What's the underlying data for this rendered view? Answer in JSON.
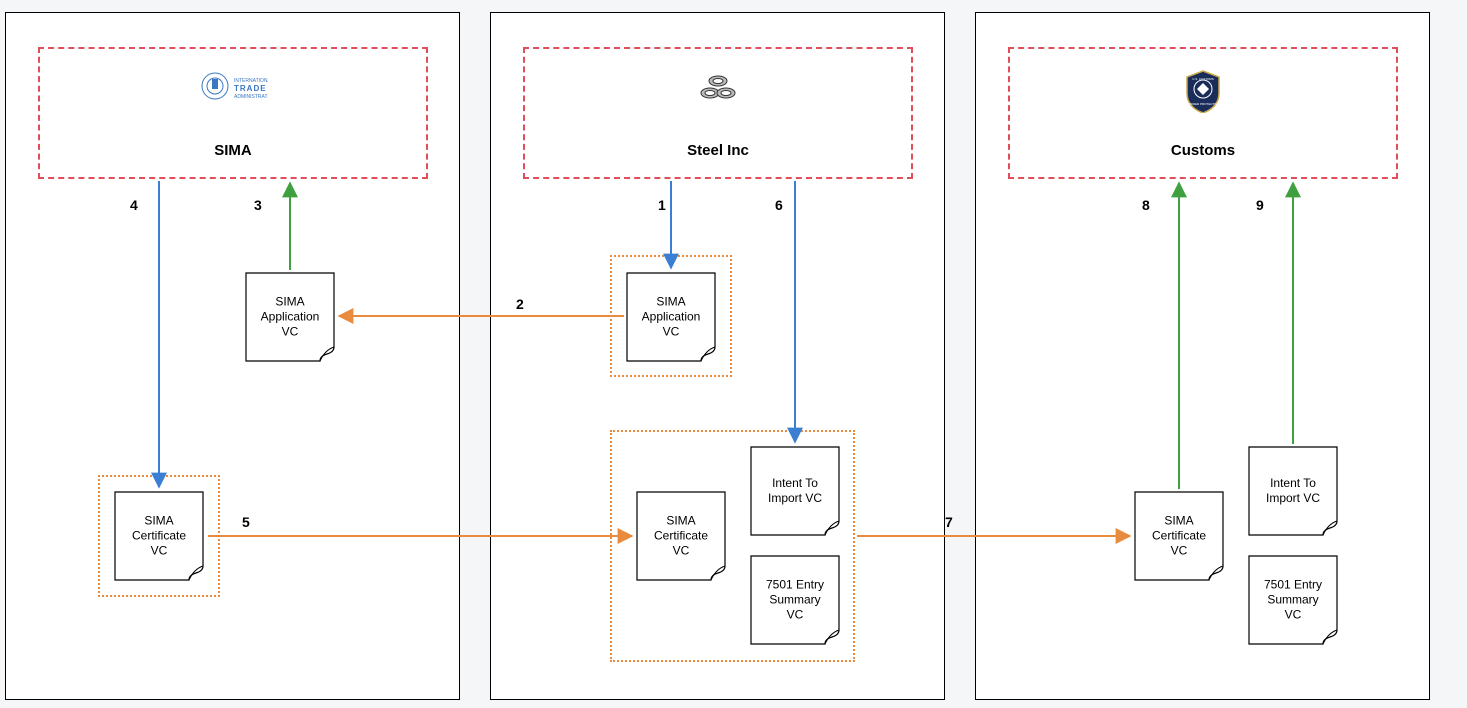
{
  "entities": {
    "sima": {
      "title": "SIMA"
    },
    "steel": {
      "title": "Steel Inc"
    },
    "customs": {
      "title": "Customs"
    }
  },
  "documents": {
    "sima_app_left": "SIMA\nApplication\nVC",
    "sima_app_mid": "SIMA\nApplication\nVC",
    "sima_cert_left": "SIMA\nCertificate\nVC",
    "sima_cert_mid": "SIMA\nCertificate\nVC",
    "sima_cert_right": "SIMA\nCertificate\nVC",
    "intent_mid": "Intent To\nImport VC",
    "intent_right": "Intent To\nImport VC",
    "entry7501_mid": "7501 Entry\nSummary\nVC",
    "entry7501_right": "7501 Entry\nSummary\nVC"
  },
  "steps": {
    "s1": "1",
    "s2": "2",
    "s3": "3",
    "s4": "4",
    "s5": "5",
    "s6": "6",
    "s7": "7",
    "s8": "8",
    "s9": "9"
  },
  "colors": {
    "panel_border": "#000000",
    "org_border": "#e04e5a",
    "wallet_border": "#e88b3f",
    "arrow_blue": "#3b7fd4",
    "arrow_green": "#3fa03f",
    "arrow_orange": "#e88b3f"
  }
}
